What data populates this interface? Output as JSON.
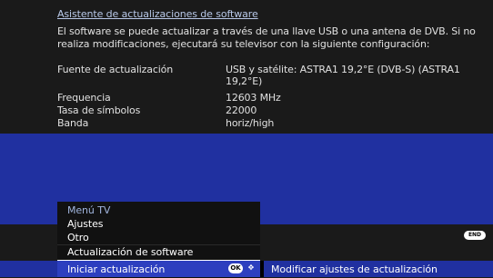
{
  "screen": {
    "title": "Asistente de actualizaciones de software",
    "description": "El software se puede actualizar a través de una llave USB o una antena de DVB. Si no realiza modificaciones, ejecutará su televisor con la siguiente configuración:",
    "settings": [
      {
        "label": "Fuente de actualización",
        "value": "USB y satélite: ASTRA1 19,2°E (DVB-S) (ASTRA1 19,2°E)"
      },
      {
        "label": "Frequencia",
        "value": "12603 MHz"
      },
      {
        "label": "Tasa de símbolos",
        "value": "22000"
      },
      {
        "label": "Banda",
        "value": "horiz/high"
      }
    ]
  },
  "menu": {
    "title": "Menú TV",
    "items": [
      "Ajustes",
      "Otro",
      "Actualización de software"
    ]
  },
  "bottom_bar": {
    "selected_action": "Iniciar actualización",
    "ok_icon": "OK",
    "nav_icon": "arrows",
    "secondary_action": "Modificar ajustes de actualización"
  },
  "end_badge": "END",
  "colors": {
    "blue_panel": "#2030a0",
    "selected_bar": "#2d3fbf",
    "title_link": "#b8c8e8"
  }
}
